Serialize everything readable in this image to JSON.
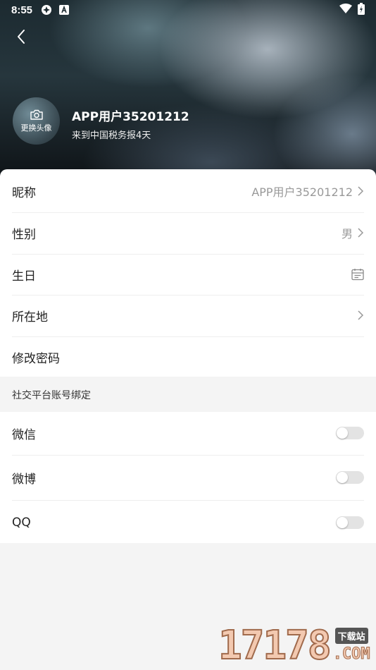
{
  "status_bar": {
    "time": "8:55"
  },
  "header": {
    "avatar_label": "更换头像",
    "user_name": "APP用户35201212",
    "user_sub": "来到中国税务报4天"
  },
  "profile_rows": [
    {
      "label": "昵称",
      "value": "APP用户35201212"
    },
    {
      "label": "性别",
      "value": "男"
    },
    {
      "label": "生日",
      "value": ""
    },
    {
      "label": "所在地",
      "value": ""
    },
    {
      "label": "修改密码",
      "value": ""
    }
  ],
  "social": {
    "section_title": "社交平台账号绑定",
    "items": [
      {
        "label": "微信",
        "bound": false
      },
      {
        "label": "微博",
        "bound": false
      },
      {
        "label": "QQ",
        "bound": false
      }
    ]
  },
  "watermark": {
    "number": "17178",
    "tag": "下载站",
    "com": ".COM"
  }
}
